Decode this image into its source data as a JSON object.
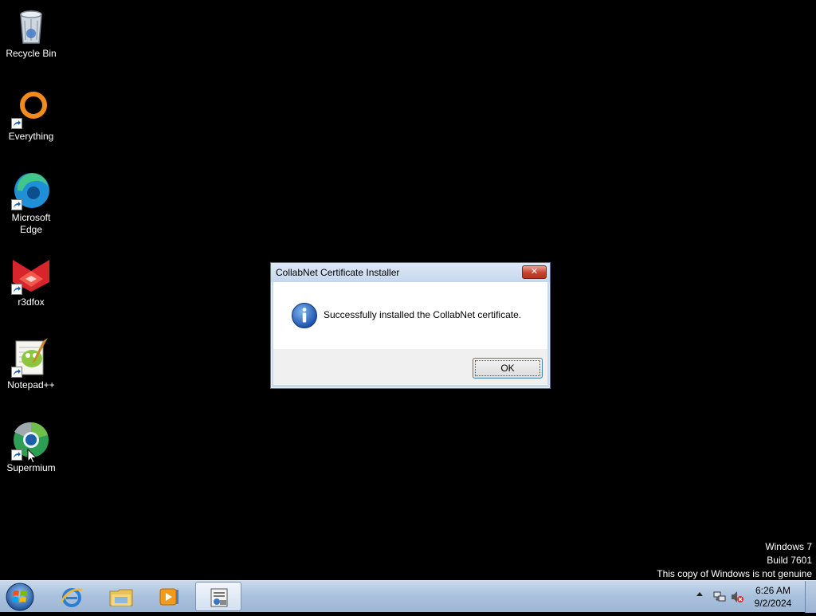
{
  "desktop": {
    "icons": [
      {
        "label": "Recycle Bin",
        "icon": "recycle-bin-icon"
      },
      {
        "label": "Everything",
        "icon": "everything-search-icon"
      },
      {
        "label": "Microsoft Edge",
        "icon": "edge-icon"
      },
      {
        "label": "r3dfox",
        "icon": "r3dfox-icon"
      },
      {
        "label": "Notepad++",
        "icon": "notepad-plus-plus-icon"
      },
      {
        "label": "Supermium",
        "icon": "supermium-icon"
      }
    ]
  },
  "dialog": {
    "title": "CollabNet Certificate Installer",
    "close_label": "✕",
    "message": "Successfully installed the CollabNet certificate.",
    "ok_label": "OK",
    "icon": "info-icon"
  },
  "watermark": {
    "line1": "Windows 7",
    "line2": "Build 7601",
    "line3": "This copy of Windows is not genuine"
  },
  "taskbar": {
    "start_icon": "windows-start-icon",
    "pinned": [
      "internet-explorer-icon",
      "file-explorer-icon",
      "media-player-icon",
      "certificate-installer-icon"
    ],
    "clock": {
      "time": "6:26 AM",
      "date": "9/2/2024"
    },
    "tray_icons": [
      "network-icon",
      "volume-muted-icon"
    ]
  },
  "colors": {
    "desktop_bg": "#000000",
    "taskbar_bg": "#a9c1dd",
    "dialog_frame": "#c9daf0",
    "close_red": "#c7432f"
  }
}
